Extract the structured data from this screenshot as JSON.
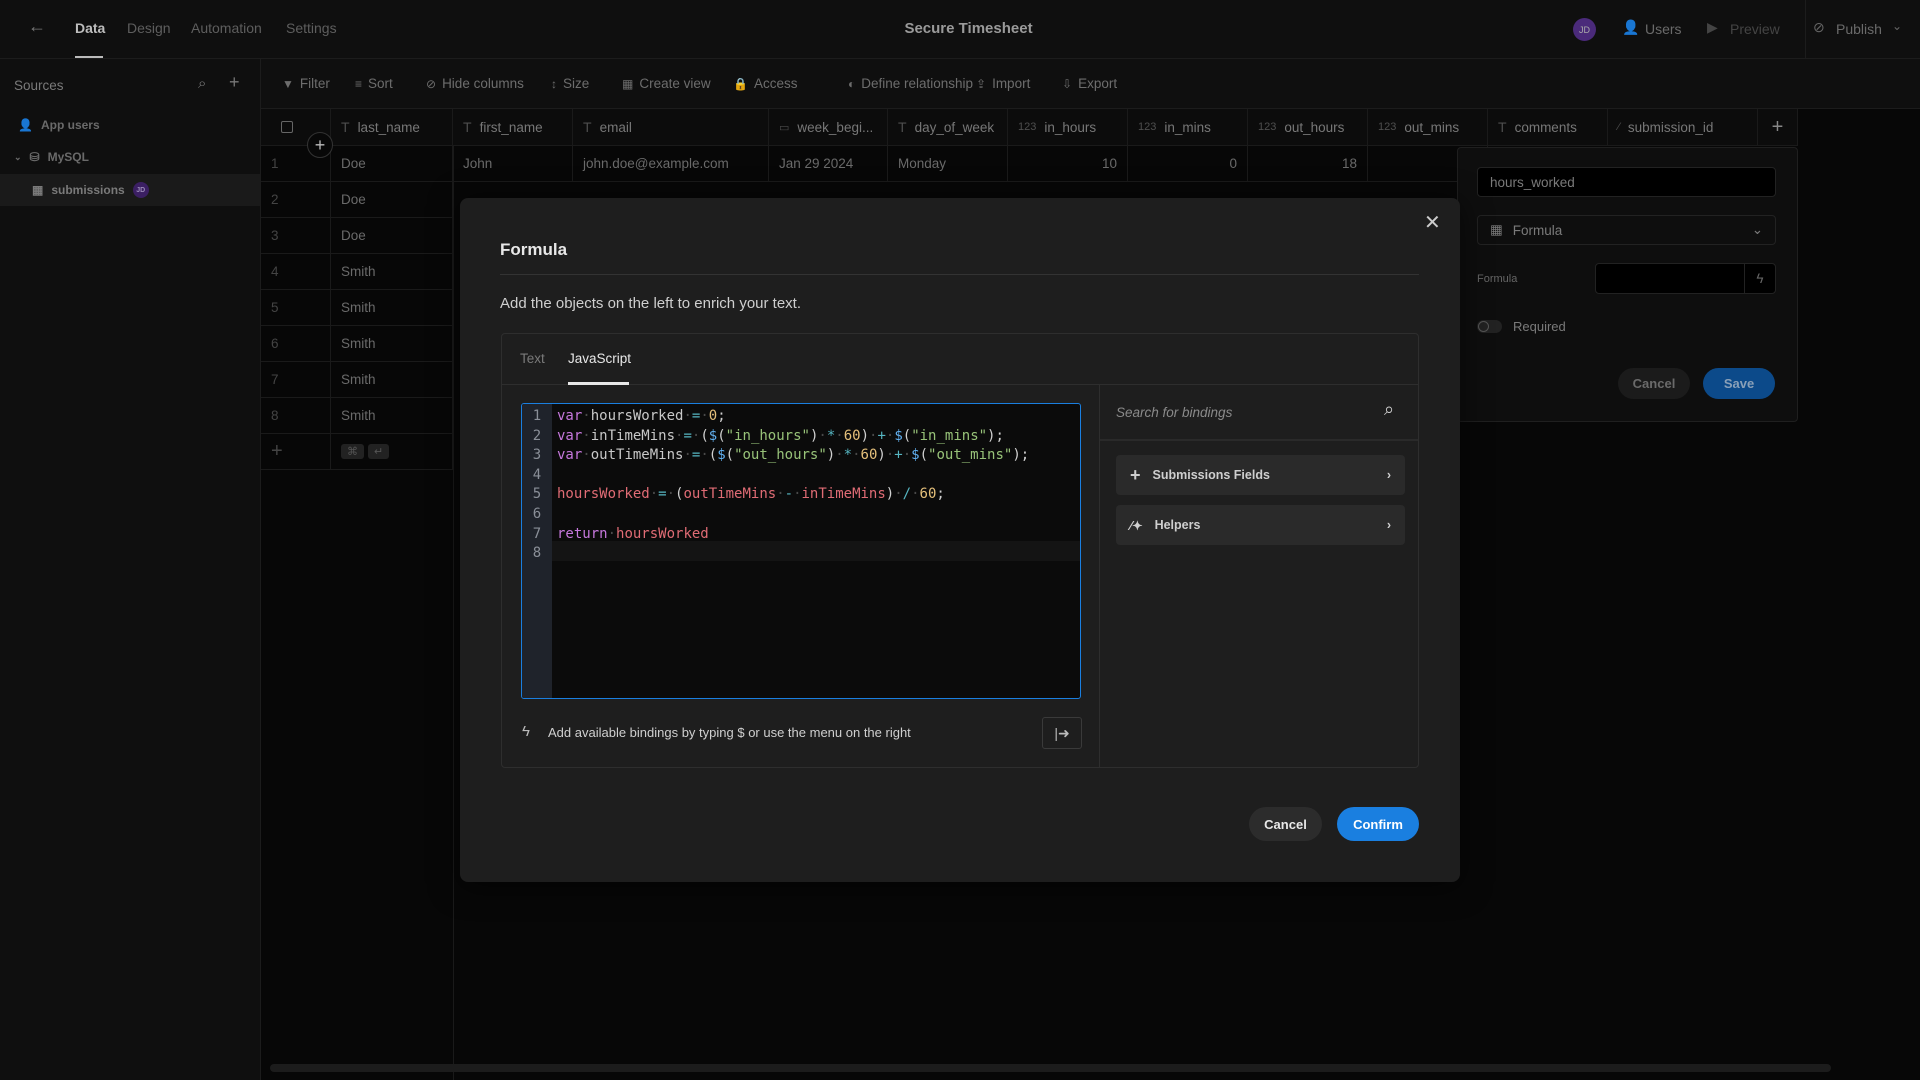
{
  "topbar": {
    "tabs": [
      {
        "label": "Data",
        "active": true
      },
      {
        "label": "Design"
      },
      {
        "label": "Automation"
      },
      {
        "label": "Settings"
      }
    ],
    "title": "Secure Timesheet",
    "avatar": "JD",
    "users": "Users",
    "preview": "Preview",
    "publish": "Publish"
  },
  "sidebar": {
    "title": "Sources",
    "items": [
      {
        "label": "App users",
        "icon": "user-icon"
      },
      {
        "label": "MySQL",
        "icon": "database-icon"
      },
      {
        "label": "submissions",
        "icon": "table-icon",
        "badge": "JD"
      }
    ]
  },
  "toolbar": [
    "Filter",
    "Sort",
    "Hide columns",
    "Size",
    "Create view",
    "Access",
    "Define relationship",
    "Import",
    "Export"
  ],
  "table": {
    "columns": [
      {
        "name": "last_name",
        "type": "T"
      },
      {
        "name": "first_name",
        "type": "T"
      },
      {
        "name": "email",
        "type": "T"
      },
      {
        "name": "week_begi...",
        "type": "date"
      },
      {
        "name": "day_of_week",
        "type": "T"
      },
      {
        "name": "in_hours",
        "type": "123"
      },
      {
        "name": "in_mins",
        "type": "123"
      },
      {
        "name": "out_hours",
        "type": "123"
      },
      {
        "name": "out_mins",
        "type": "123"
      },
      {
        "name": "comments",
        "type": "T"
      },
      {
        "name": "submission_id",
        "type": "auto"
      }
    ],
    "rows": [
      {
        "n": "1",
        "cells": [
          "Doe",
          "John",
          "john.doe@example.com",
          "Jan 29 2024",
          "Monday",
          "10",
          "0",
          "18",
          ""
        ]
      },
      {
        "n": "2",
        "cells": [
          "Doe"
        ]
      },
      {
        "n": "3",
        "cells": [
          "Doe"
        ]
      },
      {
        "n": "4",
        "cells": [
          "Smith"
        ]
      },
      {
        "n": "5",
        "cells": [
          "Smith"
        ]
      },
      {
        "n": "6",
        "cells": [
          "Smith"
        ]
      },
      {
        "n": "7",
        "cells": [
          "Smith"
        ]
      },
      {
        "n": "8",
        "cells": [
          "Smith"
        ]
      }
    ],
    "shortcut_keys": [
      "⌘",
      "↵"
    ]
  },
  "column_panel": {
    "name_value": "hours_worked",
    "type_value": "Formula",
    "formula_label": "Formula",
    "required_label": "Required",
    "required": false,
    "cancel": "Cancel",
    "save": "Save"
  },
  "modal": {
    "title": "Formula",
    "subtitle": "Add the objects on the left to enrich your text.",
    "tabs": [
      {
        "label": "Text"
      },
      {
        "label": "JavaScript",
        "active": true
      }
    ],
    "code": [
      [
        [
          "kw",
          "var"
        ],
        [
          "ws",
          "·"
        ],
        [
          "id",
          "hoursWorked"
        ],
        [
          "ws",
          "·"
        ],
        [
          "op",
          "="
        ],
        [
          "ws",
          "·"
        ],
        [
          "num",
          "0"
        ],
        [
          "p",
          ";"
        ]
      ],
      [
        [
          "kw",
          "var"
        ],
        [
          "ws",
          "·"
        ],
        [
          "id",
          "inTimeMins"
        ],
        [
          "ws",
          "·"
        ],
        [
          "op",
          "="
        ],
        [
          "ws",
          "·"
        ],
        [
          "p",
          "("
        ],
        [
          "fn",
          "$"
        ],
        [
          "p",
          "("
        ],
        [
          "str",
          "\"in_hours\""
        ],
        [
          "p",
          ")"
        ],
        [
          "ws",
          "·"
        ],
        [
          "op",
          "*"
        ],
        [
          "ws",
          "·"
        ],
        [
          "num",
          "60"
        ],
        [
          "p",
          ")"
        ],
        [
          "ws",
          "·"
        ],
        [
          "op",
          "+"
        ],
        [
          "ws",
          "·"
        ],
        [
          "fn",
          "$"
        ],
        [
          "p",
          "("
        ],
        [
          "str",
          "\"in_mins\""
        ],
        [
          "p",
          ");"
        ]
      ],
      [
        [
          "kw",
          "var"
        ],
        [
          "ws",
          "·"
        ],
        [
          "id",
          "outTimeMins"
        ],
        [
          "ws",
          "·"
        ],
        [
          "op",
          "="
        ],
        [
          "ws",
          "·"
        ],
        [
          "p",
          "("
        ],
        [
          "fn",
          "$"
        ],
        [
          "p",
          "("
        ],
        [
          "str",
          "\"out_hours\""
        ],
        [
          "p",
          ")"
        ],
        [
          "ws",
          "·"
        ],
        [
          "op",
          "*"
        ],
        [
          "ws",
          "·"
        ],
        [
          "num",
          "60"
        ],
        [
          "p",
          ")"
        ],
        [
          "ws",
          "·"
        ],
        [
          "op",
          "+"
        ],
        [
          "ws",
          "·"
        ],
        [
          "fn",
          "$"
        ],
        [
          "p",
          "("
        ],
        [
          "str",
          "\"out_mins\""
        ],
        [
          "p",
          ");"
        ]
      ],
      [],
      [
        [
          "var",
          "hoursWorked"
        ],
        [
          "ws",
          "·"
        ],
        [
          "op",
          "="
        ],
        [
          "ws",
          "·"
        ],
        [
          "p",
          "("
        ],
        [
          "var",
          "outTimeMins"
        ],
        [
          "ws",
          "·"
        ],
        [
          "op",
          "-"
        ],
        [
          "ws",
          "·"
        ],
        [
          "var",
          "inTimeMins"
        ],
        [
          "p",
          ")"
        ],
        [
          "ws",
          "·"
        ],
        [
          "op",
          "/"
        ],
        [
          "ws",
          "·"
        ],
        [
          "num",
          "60"
        ],
        [
          "p",
          ";"
        ]
      ],
      [],
      [
        [
          "kw",
          "return"
        ],
        [
          "ws",
          "·"
        ],
        [
          "var",
          "hoursWorked"
        ]
      ],
      []
    ],
    "search_placeholder": "Search for bindings",
    "binding_groups": [
      {
        "label": "Submissions Fields",
        "icon": "plus-icon"
      },
      {
        "label": "Helpers",
        "icon": "magic-wand-icon"
      }
    ],
    "hint": "Add available bindings by typing $ or use the menu on the right",
    "cancel": "Cancel",
    "confirm": "Confirm"
  },
  "colors": {
    "accent": "#1a7fe0",
    "save": "#0c4a8a",
    "avatar": "#4a2a7a",
    "keyword": "#c678dd",
    "string": "#98c379",
    "number": "#e5c07b",
    "variable": "#e06c75"
  }
}
